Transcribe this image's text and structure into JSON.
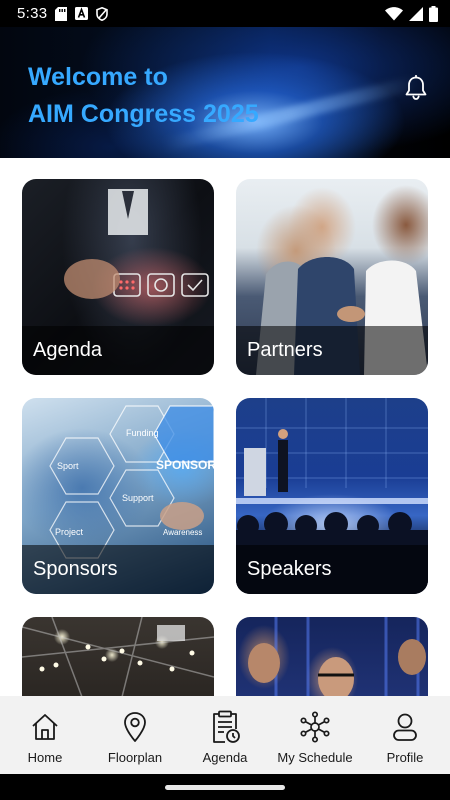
{
  "status_bar": {
    "time": "5:33",
    "icons_left": [
      "sd-card-icon",
      "a-badge-icon",
      "shield-icon"
    ],
    "icons_right": [
      "wifi-icon",
      "signal-icon",
      "battery-icon"
    ]
  },
  "hero": {
    "title_line1": "Welcome to",
    "title_line2": "AIM Congress 2025",
    "title_color": "#36a9ff",
    "notification_icon": "bell-icon"
  },
  "tiles": [
    {
      "label": "Agenda"
    },
    {
      "label": "Partners"
    },
    {
      "label": "Sponsors"
    },
    {
      "label": "Speakers"
    },
    {
      "label": ""
    },
    {
      "label": ""
    }
  ],
  "sponsors_image_words": [
    "Funding",
    "Sport",
    "SPONSOR",
    "Support",
    "Project",
    "Awareness"
  ],
  "bottom_nav": [
    {
      "label": "Home",
      "icon": "home-icon"
    },
    {
      "label": "Floorplan",
      "icon": "map-pin-icon"
    },
    {
      "label": "Agenda",
      "icon": "clipboard-clock-icon"
    },
    {
      "label": "My Schedule",
      "icon": "network-icon"
    },
    {
      "label": "Profile",
      "icon": "user-icon"
    }
  ]
}
